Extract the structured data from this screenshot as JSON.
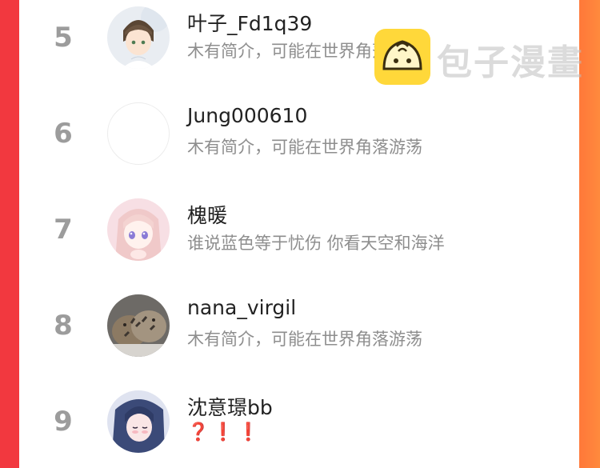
{
  "list": [
    {
      "rank": "5",
      "name": "叶子_Fd1q39",
      "bio": "木有简介，可能在世界角落游荡",
      "avatar": "anime-boy-avatar"
    },
    {
      "rank": "6",
      "name": "Jung000610",
      "bio": "木有简介，可能在世界角落游荡",
      "avatar": "blank-avatar"
    },
    {
      "rank": "7",
      "name": "槐暖",
      "bio": "谁说蓝色等于忧伤 你看天空和海洋",
      "avatar": "anime-girl-pink-avatar"
    },
    {
      "rank": "8",
      "name": "nana_virgil",
      "bio": "木有简介，可能在世界角落游荡",
      "avatar": "cats-avatar"
    },
    {
      "rank": "9",
      "name": "沈意璟bb",
      "bio": "❓❗❗",
      "avatar": "anime-girl-blue-avatar"
    }
  ],
  "watermark": {
    "text": "包子漫畫",
    "logo": "baozi-bun-icon"
  },
  "colors": {
    "background_left": "#f2383f",
    "background_right": "#ff8a3d",
    "rank": "#9c9c9c",
    "bio": "#8e8e8e",
    "alert": "#e02020"
  }
}
